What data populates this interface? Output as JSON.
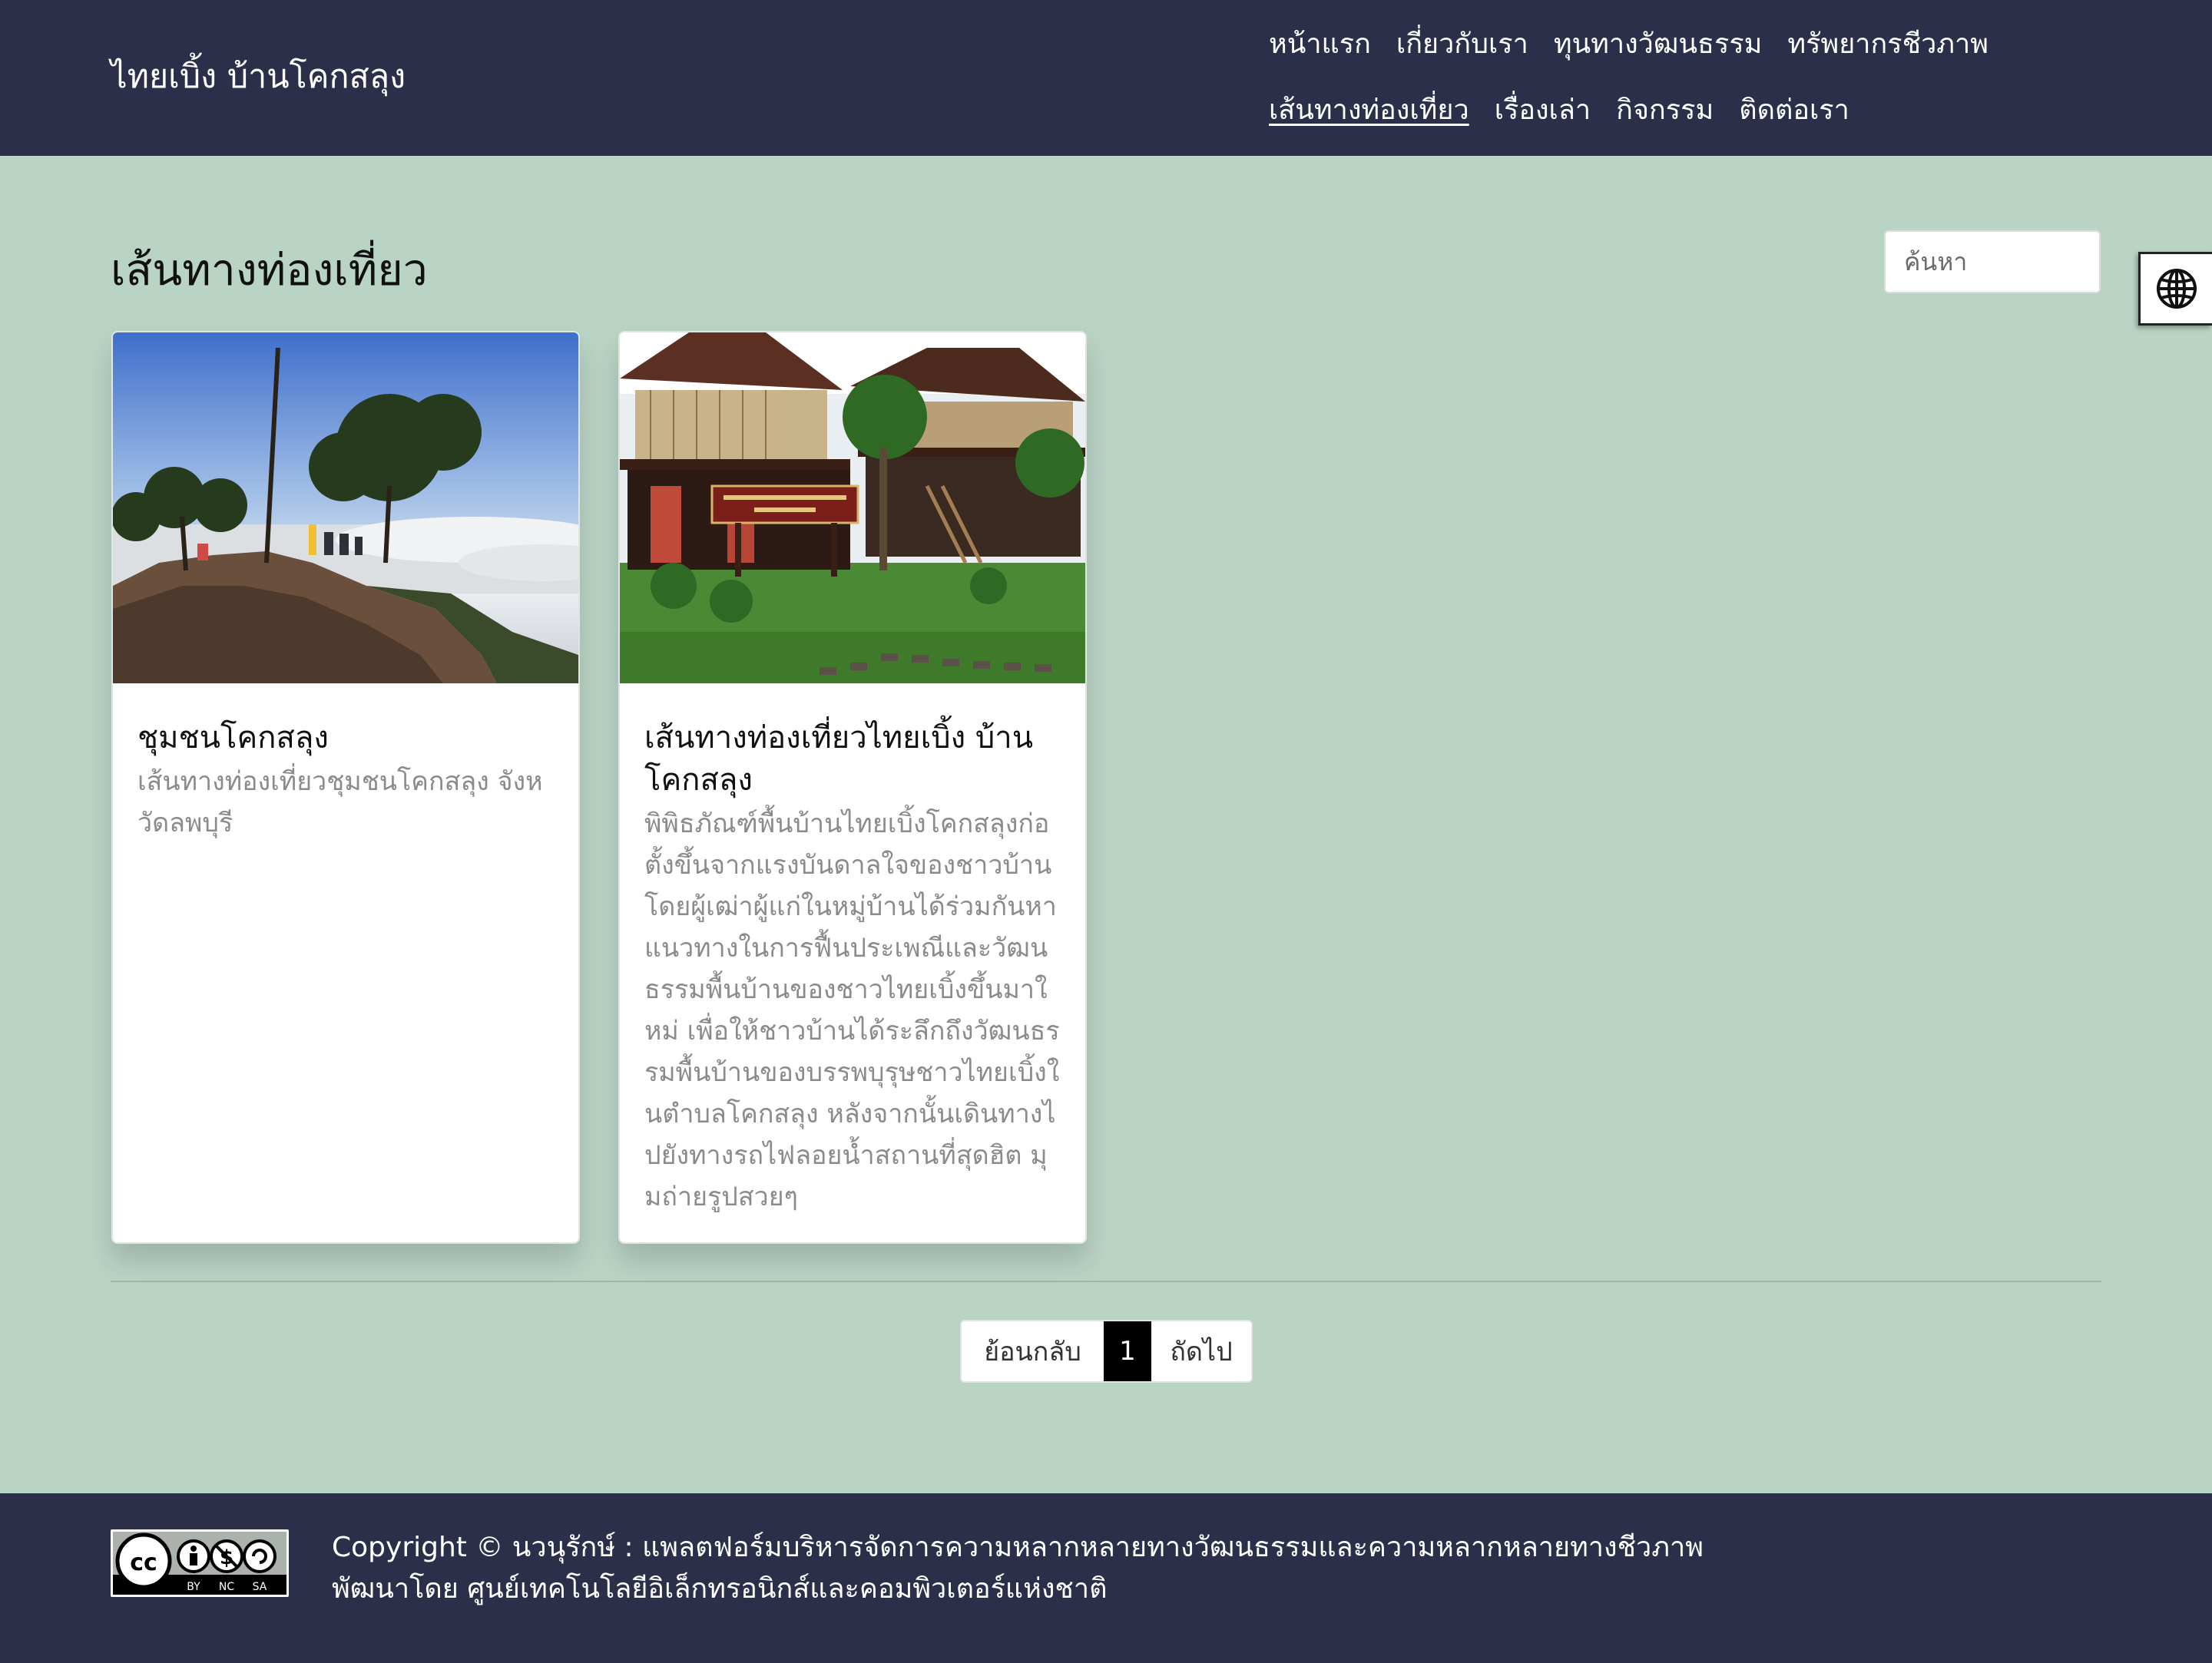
{
  "header": {
    "brand": "ไทยเบิ้ง บ้านโคกสลุง",
    "nav": [
      {
        "label": "หน้าแรก",
        "active": false
      },
      {
        "label": "เกี่ยวกับเรา",
        "active": false
      },
      {
        "label": "ทุนทางวัฒนธรรม",
        "active": false
      },
      {
        "label": "ทรัพยากรชีวภาพ",
        "active": false
      },
      {
        "label": "เส้นทางท่องเที่ยว",
        "active": true
      },
      {
        "label": "เรื่องเล่า",
        "active": false
      },
      {
        "label": "กิจกรรม",
        "active": false
      },
      {
        "label": "ติดต่อเรา",
        "active": false
      }
    ]
  },
  "main": {
    "title": "เส้นทางท่องเที่ยว",
    "search": {
      "placeholder": "ค้นหา",
      "value": ""
    },
    "language_icon": "globe-icon",
    "cards": [
      {
        "image": "viewpoint-sea-of-mist-photo",
        "title": "ชุมชนโคกสลุง",
        "description": "เส้นทางท่องเที่ยวชุมชนโคกสลุง จังหวัดลพบุรี"
      },
      {
        "image": "folk-museum-house-photo",
        "title": "เส้นทางท่องเที่ยวไทยเบิ้ง บ้านโคกสลุง",
        "description": "พิพิธภัณฑ์พื้นบ้านไทยเบิ้งโคกสลุงก่อตั้งขึ้นจากแรงบันดาลใจของชาวบ้าน โดยผู้เฒ่าผู้แก่ในหมู่บ้านได้ร่วมกันหาแนวทางในการฟื้นประเพณีและวัฒนธรรมพื้นบ้านของชาวไทยเบิ้งขึ้นมาใหม่ เพื่อให้ชาวบ้านได้ระลึกถึงวัฒนธรรมพื้นบ้านของบรรพบุรุษชาวไทยเบิ้งในตำบลโคกสลุง หลังจากนั้นเดินทางไปยังทางรถไฟลอยน้ำสถานที่สุดฮิต มุมถ่ายรูปสวยๆ"
      }
    ],
    "pagination": {
      "prev": "ย้อนกลับ",
      "current": "1",
      "next": "ถัดไป"
    }
  },
  "footer": {
    "license_badge": {
      "icon": "cc-by-nc-sa-icon",
      "labels": [
        "BY",
        "NC",
        "SA"
      ]
    },
    "copyright": "Copyright © นวนุรักษ์ : แพลตฟอร์มบริหารจัดการความหลากหลายทางวัฒนธรรมและความหลากหลายทางชีวภาพ",
    "developer": "พัฒนาโดย ศูนย์เทคโนโลยีอิเล็กทรอนิกส์และคอมพิวเตอร์แห่งชาติ"
  },
  "colors": {
    "header_bg": "#2b2f4a",
    "page_bg": "#b9d3c5",
    "card_bg": "#ffffff",
    "pagination_active": "#000000"
  }
}
